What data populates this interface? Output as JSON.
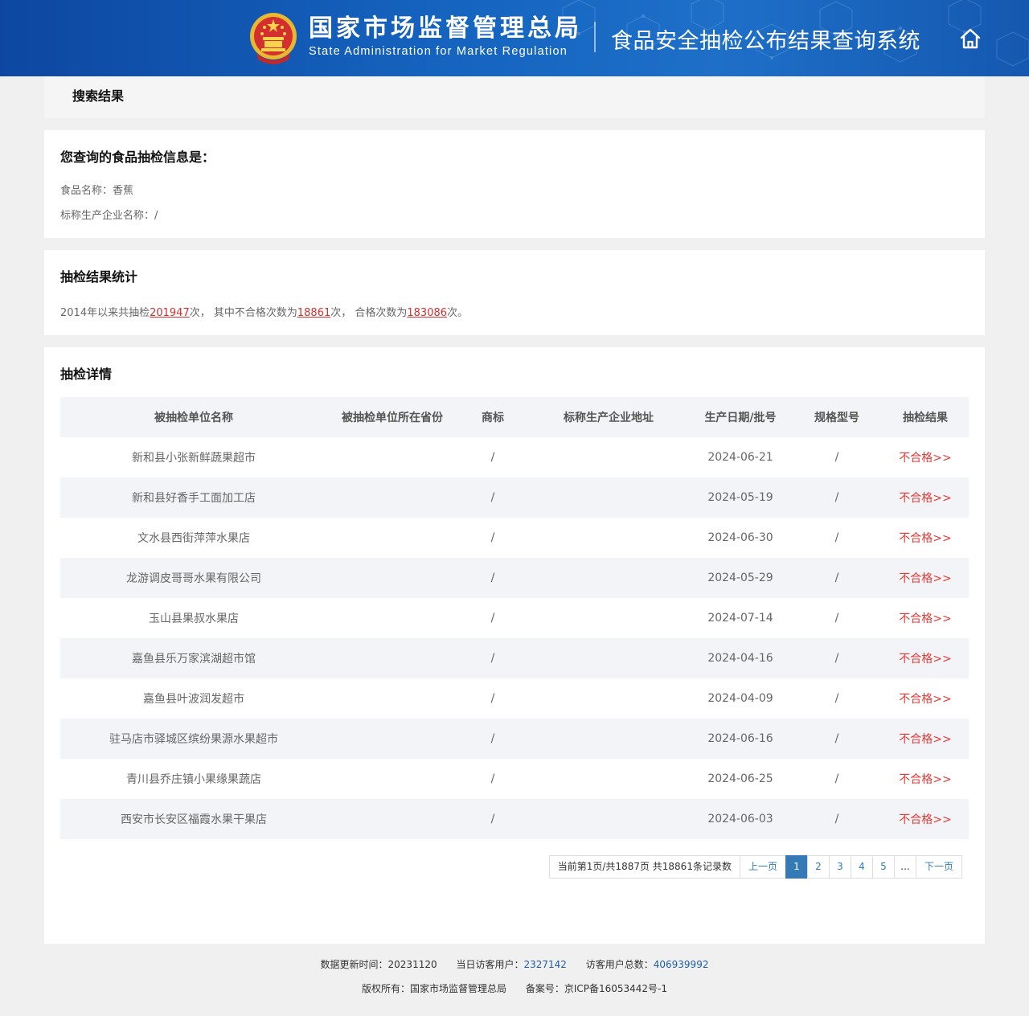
{
  "header": {
    "agency_cn": "国家市场监督管理总局",
    "agency_en": "State Administration  for  Market Regulation",
    "system_name": "食品安全抽检公布结果查询系统",
    "home_icon": "home-icon",
    "emblem_icon": "national-emblem-icon",
    "colors": {
      "bg_start": "#0d47a1",
      "bg_end": "#1e6fc8"
    }
  },
  "breadcrumb": {
    "title": "搜索结果"
  },
  "query": {
    "heading": "您查询的食品抽检信息是：",
    "food_name": "食品名称：香蕉",
    "manufacturer": "标称生产企业名称：/"
  },
  "stats": {
    "heading": "抽检结果统计",
    "prefix": "2014年以来共抽检",
    "total": "201947",
    "mid1": "次，  其中不合格次数为",
    "failed": "18861",
    "mid2": "次，  合格次数为",
    "passed": "183086",
    "suffix": "次。"
  },
  "details": {
    "heading": "抽检详情",
    "columns": [
      "被抽检单位名称",
      "被抽检单位所在省份",
      "商标",
      "标称生产企业地址",
      "生产日期/批号",
      "规格型号",
      "抽检结果"
    ],
    "rows": [
      [
        "新和县小张新鲜蔬果超市",
        "",
        "/",
        "",
        "2024-06-21",
        "/",
        "不合格>>"
      ],
      [
        "新和县好香手工面加工店",
        "",
        "/",
        "",
        "2024-05-19",
        "/",
        "不合格>>"
      ],
      [
        "文水县西街萍萍水果店",
        "",
        "/",
        "",
        "2024-06-30",
        "/",
        "不合格>>"
      ],
      [
        "龙游调皮哥哥水果有限公司",
        "",
        "/",
        "",
        "2024-05-29",
        "/",
        "不合格>>"
      ],
      [
        "玉山县果叔水果店",
        "",
        "/",
        "",
        "2024-07-14",
        "/",
        "不合格>>"
      ],
      [
        "嘉鱼县乐万家滨湖超市馆",
        "",
        "/",
        "",
        "2024-04-16",
        "/",
        "不合格>>"
      ],
      [
        "嘉鱼县叶波润发超市",
        "",
        "/",
        "",
        "2024-04-09",
        "/",
        "不合格>>"
      ],
      [
        "驻马店市驿城区缤纷果源水果超市",
        "",
        "/",
        "",
        "2024-06-16",
        "/",
        "不合格>>"
      ],
      [
        "青川县乔庄镇小果缘果蔬店",
        "",
        "/",
        "",
        "2024-06-25",
        "/",
        "不合格>>"
      ],
      [
        "西安市长安区福霞水果干果店",
        "",
        "/",
        "",
        "2024-06-03",
        "/",
        "不合格>>"
      ]
    ]
  },
  "pagination": {
    "info": "当前第1页/共1887页 共18861条记录数",
    "prev": "上一页",
    "pages": [
      "1",
      "2",
      "3",
      "4",
      "5"
    ],
    "current_page": "1",
    "ellipsis": "...",
    "next": "下一页"
  },
  "footer": {
    "update_label": "数据更新时间：",
    "update_value": "20231120",
    "visitors_today_label": "当日访客用户：",
    "visitors_today": "2327142",
    "visitors_total_label": "访客用户总数：",
    "visitors_total": "406939992",
    "copyright": "版权所有：国家市场监督管理总局",
    "icp": "备案号：京ICP备16053442号-1"
  }
}
